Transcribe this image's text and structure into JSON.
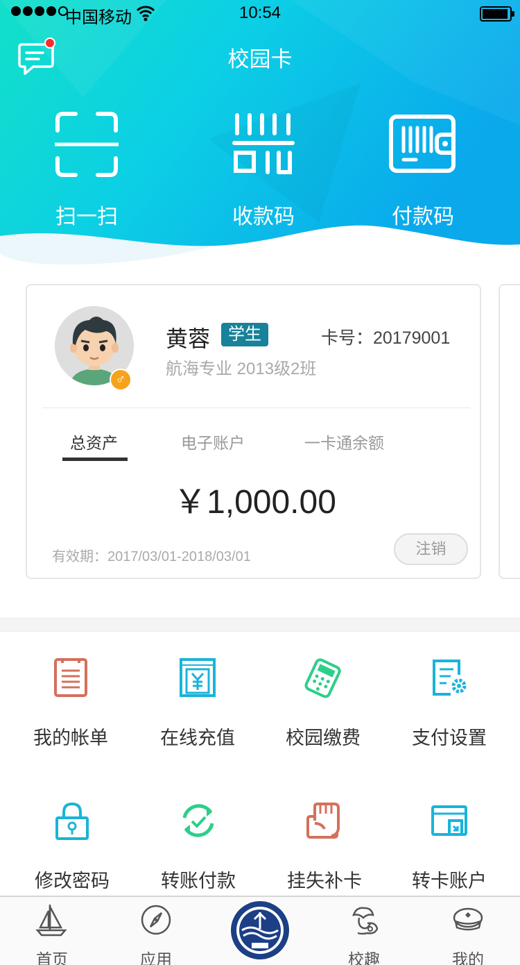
{
  "status_bar": {
    "carrier": "中国移动",
    "time": "10:54"
  },
  "header": {
    "title": "校园卡",
    "quick_actions": [
      {
        "label": "扫一扫",
        "icon": "scan-icon"
      },
      {
        "label": "收款码",
        "icon": "receive-code-icon"
      },
      {
        "label": "付款码",
        "icon": "pay-code-icon"
      }
    ]
  },
  "card": {
    "name": "黄蓉",
    "role": "学生",
    "card_no": "卡号：20179001",
    "major": "航海专业 2013级2班",
    "tabs": [
      "总资产",
      "电子账户",
      "一卡通余额"
    ],
    "amount": "￥1,000.00",
    "validity": "有效期：2017/03/01-2018/03/01",
    "cancel_label": "注销"
  },
  "services": [
    {
      "label": "我的帐单",
      "icon": "bill-icon",
      "color": "#d4705c"
    },
    {
      "label": "在线充值",
      "icon": "recharge-icon",
      "color": "#1ab4d8"
    },
    {
      "label": "校园缴费",
      "icon": "pos-terminal-icon",
      "color": "#2ccf8a"
    },
    {
      "label": "支付设置",
      "icon": "pay-settings-icon",
      "color": "#1ab4d8"
    },
    {
      "label": "修改密码",
      "icon": "lock-icon",
      "color": "#1ab4d8"
    },
    {
      "label": "转账付款",
      "icon": "transfer-icon",
      "color": "#2ccf8a"
    },
    {
      "label": "挂失补卡",
      "icon": "report-loss-icon",
      "color": "#d4705c"
    },
    {
      "label": "转卡账户",
      "icon": "card-account-icon",
      "color": "#1ab4d8"
    }
  ],
  "tabbar": {
    "items": [
      {
        "label": "首页",
        "icon": "sailboat-icon"
      },
      {
        "label": "应用",
        "icon": "compass-icon"
      },
      {
        "label": "",
        "icon": "university-logo"
      },
      {
        "label": "校趣",
        "icon": "sailor-icon"
      },
      {
        "label": "我的",
        "icon": "captain-hat-icon"
      }
    ]
  }
}
